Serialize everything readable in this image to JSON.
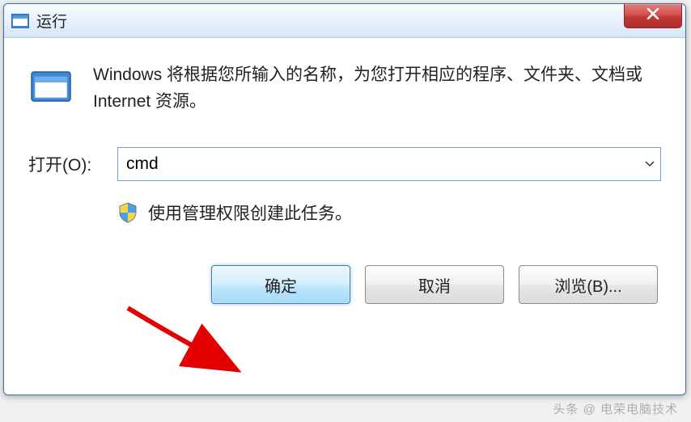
{
  "window": {
    "title": "运行"
  },
  "content": {
    "description": "Windows 将根据您所输入的名称，为您打开相应的程序、文件夹、文档或 Internet 资源。",
    "open_label": "打开(O):",
    "input_value": "cmd",
    "admin_text": "使用管理权限创建此任务。"
  },
  "buttons": {
    "ok": "确定",
    "cancel": "取消",
    "browse": "浏览(B)..."
  },
  "watermark": "头条 @ 电荣电脑技术"
}
